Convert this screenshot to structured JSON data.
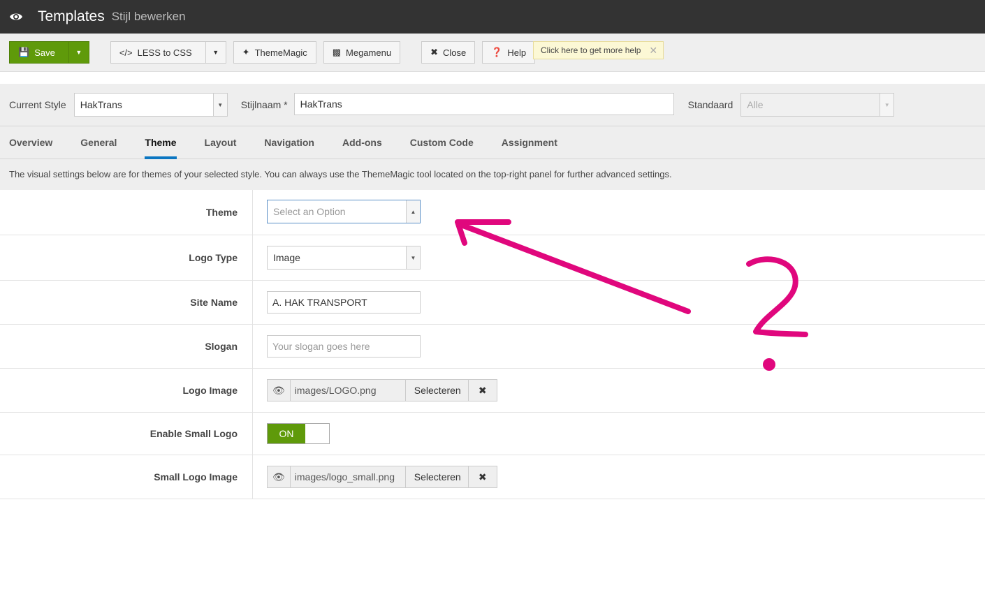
{
  "header": {
    "title": "Templates",
    "subtitle": "Stijl bewerken"
  },
  "toolbar": {
    "save": "Save",
    "less": "LESS to CSS",
    "thememagic": "ThemeMagic",
    "megamenu": "Megamenu",
    "close": "Close",
    "help": "Help",
    "tip": "Click here to get more help"
  },
  "style": {
    "current_label": "Current Style",
    "current_value": "HakTrans",
    "name_label": "Stijlnaam *",
    "name_value": "HakTrans",
    "default_label": "Standaard",
    "default_value": "Alle"
  },
  "tabs": [
    "Overview",
    "General",
    "Theme",
    "Layout",
    "Navigation",
    "Add-ons",
    "Custom Code",
    "Assignment"
  ],
  "description": "The visual settings below are for themes of your selected style. You can always use the ThemeMagic tool located on the top-right panel for further advanced settings.",
  "form": {
    "theme": {
      "label": "Theme",
      "placeholder": "Select an Option"
    },
    "logo_type": {
      "label": "Logo Type",
      "value": "Image"
    },
    "site_name": {
      "label": "Site Name",
      "value": "A. HAK TRANSPORT"
    },
    "slogan": {
      "label": "Slogan",
      "placeholder": "Your slogan goes here"
    },
    "logo_image": {
      "label": "Logo Image",
      "value": "images/LOGO.png",
      "select": "Selecteren"
    },
    "small_logo": {
      "label": "Enable Small Logo",
      "state": "ON"
    },
    "small_logo_image": {
      "label": "Small Logo Image",
      "value": "images/logo_small.png",
      "select": "Selecteren"
    }
  },
  "annotation": {
    "color": "#e0077d",
    "mark": "?"
  }
}
